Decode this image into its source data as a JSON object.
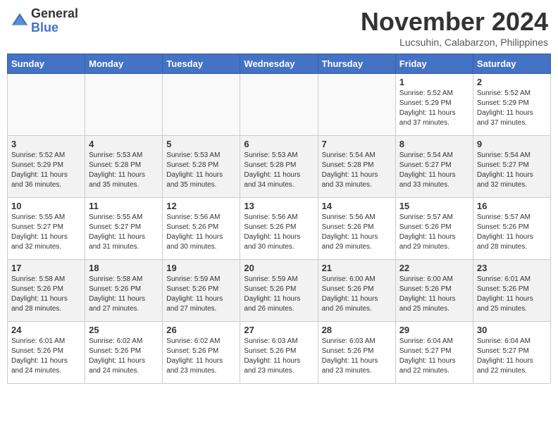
{
  "header": {
    "logo_line1": "General",
    "logo_line2": "Blue",
    "month": "November 2024",
    "location": "Lucsuhin, Calabarzon, Philippines"
  },
  "weekdays": [
    "Sunday",
    "Monday",
    "Tuesday",
    "Wednesday",
    "Thursday",
    "Friday",
    "Saturday"
  ],
  "weeks": [
    [
      {
        "day": "",
        "info": ""
      },
      {
        "day": "",
        "info": ""
      },
      {
        "day": "",
        "info": ""
      },
      {
        "day": "",
        "info": ""
      },
      {
        "day": "",
        "info": ""
      },
      {
        "day": "1",
        "info": "Sunrise: 5:52 AM\nSunset: 5:29 PM\nDaylight: 11 hours\nand 37 minutes."
      },
      {
        "day": "2",
        "info": "Sunrise: 5:52 AM\nSunset: 5:29 PM\nDaylight: 11 hours\nand 37 minutes."
      }
    ],
    [
      {
        "day": "3",
        "info": "Sunrise: 5:52 AM\nSunset: 5:29 PM\nDaylight: 11 hours\nand 36 minutes."
      },
      {
        "day": "4",
        "info": "Sunrise: 5:53 AM\nSunset: 5:28 PM\nDaylight: 11 hours\nand 35 minutes."
      },
      {
        "day": "5",
        "info": "Sunrise: 5:53 AM\nSunset: 5:28 PM\nDaylight: 11 hours\nand 35 minutes."
      },
      {
        "day": "6",
        "info": "Sunrise: 5:53 AM\nSunset: 5:28 PM\nDaylight: 11 hours\nand 34 minutes."
      },
      {
        "day": "7",
        "info": "Sunrise: 5:54 AM\nSunset: 5:28 PM\nDaylight: 11 hours\nand 33 minutes."
      },
      {
        "day": "8",
        "info": "Sunrise: 5:54 AM\nSunset: 5:27 PM\nDaylight: 11 hours\nand 33 minutes."
      },
      {
        "day": "9",
        "info": "Sunrise: 5:54 AM\nSunset: 5:27 PM\nDaylight: 11 hours\nand 32 minutes."
      }
    ],
    [
      {
        "day": "10",
        "info": "Sunrise: 5:55 AM\nSunset: 5:27 PM\nDaylight: 11 hours\nand 32 minutes."
      },
      {
        "day": "11",
        "info": "Sunrise: 5:55 AM\nSunset: 5:27 PM\nDaylight: 11 hours\nand 31 minutes."
      },
      {
        "day": "12",
        "info": "Sunrise: 5:56 AM\nSunset: 5:26 PM\nDaylight: 11 hours\nand 30 minutes."
      },
      {
        "day": "13",
        "info": "Sunrise: 5:56 AM\nSunset: 5:26 PM\nDaylight: 11 hours\nand 30 minutes."
      },
      {
        "day": "14",
        "info": "Sunrise: 5:56 AM\nSunset: 5:26 PM\nDaylight: 11 hours\nand 29 minutes."
      },
      {
        "day": "15",
        "info": "Sunrise: 5:57 AM\nSunset: 5:26 PM\nDaylight: 11 hours\nand 29 minutes."
      },
      {
        "day": "16",
        "info": "Sunrise: 5:57 AM\nSunset: 5:26 PM\nDaylight: 11 hours\nand 28 minutes."
      }
    ],
    [
      {
        "day": "17",
        "info": "Sunrise: 5:58 AM\nSunset: 5:26 PM\nDaylight: 11 hours\nand 28 minutes."
      },
      {
        "day": "18",
        "info": "Sunrise: 5:58 AM\nSunset: 5:26 PM\nDaylight: 11 hours\nand 27 minutes."
      },
      {
        "day": "19",
        "info": "Sunrise: 5:59 AM\nSunset: 5:26 PM\nDaylight: 11 hours\nand 27 minutes."
      },
      {
        "day": "20",
        "info": "Sunrise: 5:59 AM\nSunset: 5:26 PM\nDaylight: 11 hours\nand 26 minutes."
      },
      {
        "day": "21",
        "info": "Sunrise: 6:00 AM\nSunset: 5:26 PM\nDaylight: 11 hours\nand 26 minutes."
      },
      {
        "day": "22",
        "info": "Sunrise: 6:00 AM\nSunset: 5:26 PM\nDaylight: 11 hours\nand 25 minutes."
      },
      {
        "day": "23",
        "info": "Sunrise: 6:01 AM\nSunset: 5:26 PM\nDaylight: 11 hours\nand 25 minutes."
      }
    ],
    [
      {
        "day": "24",
        "info": "Sunrise: 6:01 AM\nSunset: 5:26 PM\nDaylight: 11 hours\nand 24 minutes."
      },
      {
        "day": "25",
        "info": "Sunrise: 6:02 AM\nSunset: 5:26 PM\nDaylight: 11 hours\nand 24 minutes."
      },
      {
        "day": "26",
        "info": "Sunrise: 6:02 AM\nSunset: 5:26 PM\nDaylight: 11 hours\nand 23 minutes."
      },
      {
        "day": "27",
        "info": "Sunrise: 6:03 AM\nSunset: 5:26 PM\nDaylight: 11 hours\nand 23 minutes."
      },
      {
        "day": "28",
        "info": "Sunrise: 6:03 AM\nSunset: 5:26 PM\nDaylight: 11 hours\nand 23 minutes."
      },
      {
        "day": "29",
        "info": "Sunrise: 6:04 AM\nSunset: 5:27 PM\nDaylight: 11 hours\nand 22 minutes."
      },
      {
        "day": "30",
        "info": "Sunrise: 6:04 AM\nSunset: 5:27 PM\nDaylight: 11 hours\nand 22 minutes."
      }
    ]
  ]
}
